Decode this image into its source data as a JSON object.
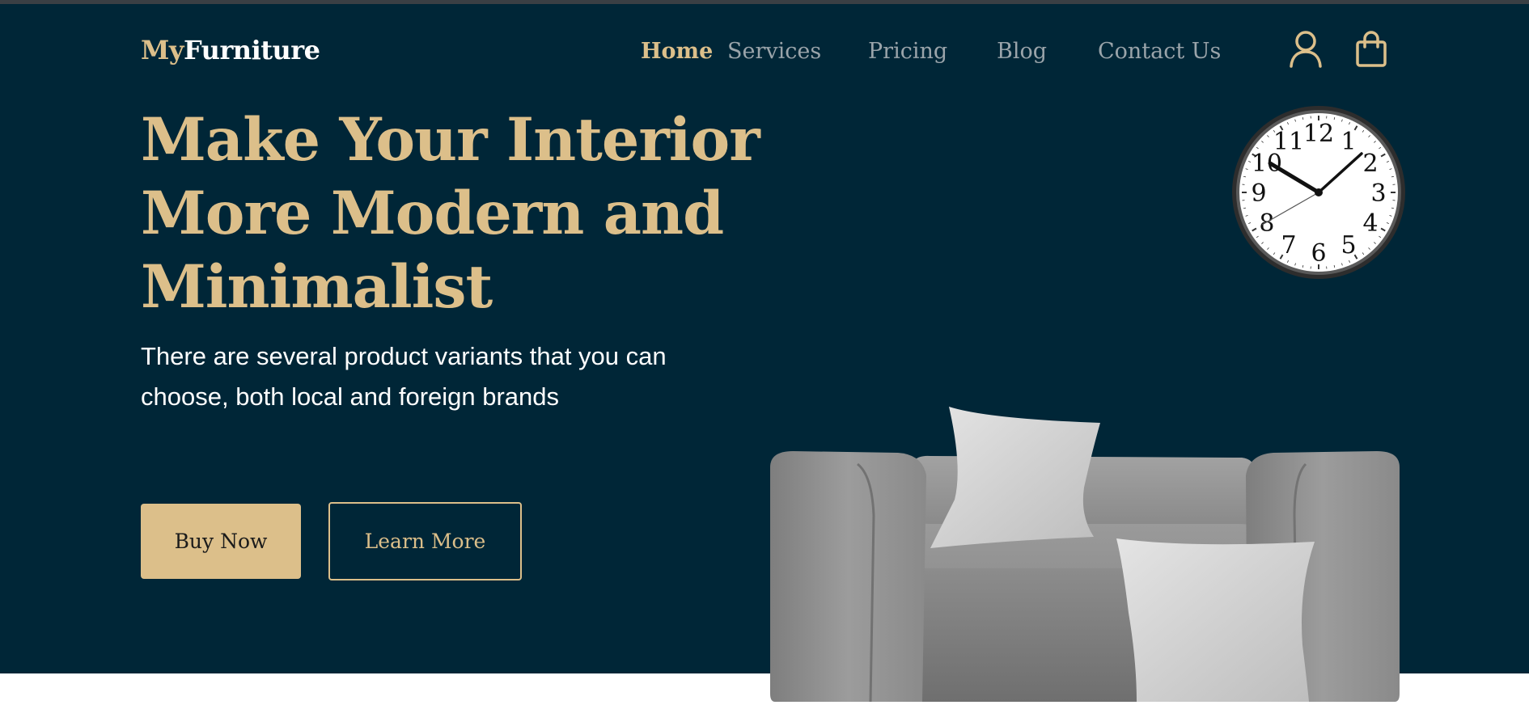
{
  "brand": {
    "part1": "My",
    "part2": "Furniture"
  },
  "nav": {
    "home": "Home",
    "services": "Services",
    "pricing": "Pricing",
    "blog": "Blog",
    "contact": "Contact Us"
  },
  "header_icons": {
    "account": "user-icon",
    "cart": "shopping-bag-icon"
  },
  "hero": {
    "title_line1": "Make Your Interior",
    "title_line2": "More Modern and",
    "title_line3": "Minimalist",
    "sub_line1": "There are several product variants that you can",
    "sub_line2": "choose, both local and foreign brands",
    "buy_label": "Buy Now",
    "learn_label": "Learn More"
  },
  "clock": {
    "numerals": [
      "12",
      "1",
      "2",
      "3",
      "4",
      "5",
      "6",
      "7",
      "8",
      "9",
      "10",
      "11"
    ]
  },
  "colors": {
    "background": "#002637",
    "accent": "#dcbf8a",
    "nav_text": "#9aa4aa",
    "text": "#ffffff"
  }
}
